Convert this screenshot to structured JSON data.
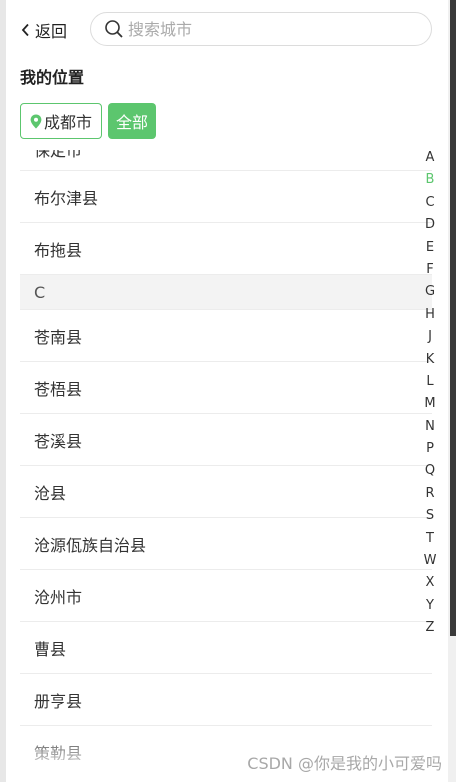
{
  "header": {
    "back_label": "返回",
    "search_placeholder": "搜索城市"
  },
  "location": {
    "title": "我的位置",
    "current_city": "成都市",
    "all_label": "全部"
  },
  "list": {
    "partial_top": "保定市",
    "b_items": [
      "布尔津县",
      "布拖县"
    ],
    "c_header": "C",
    "c_items": [
      "苍南县",
      "苍梧县",
      "苍溪县",
      "沧县",
      "沧源佤族自治县",
      "沧州市",
      "曹县",
      "册亨县"
    ],
    "partial_bottom": "策勒县"
  },
  "index": {
    "letters": [
      "A",
      "B",
      "C",
      "D",
      "E",
      "F",
      "G",
      "H",
      "J",
      "K",
      "L",
      "M",
      "N",
      "P",
      "Q",
      "R",
      "S",
      "T",
      "W",
      "X",
      "Y",
      "Z"
    ],
    "active": "B"
  },
  "watermark": "CSDN @你是我的小可爱吗",
  "colors": {
    "accent": "#5cc66e"
  }
}
